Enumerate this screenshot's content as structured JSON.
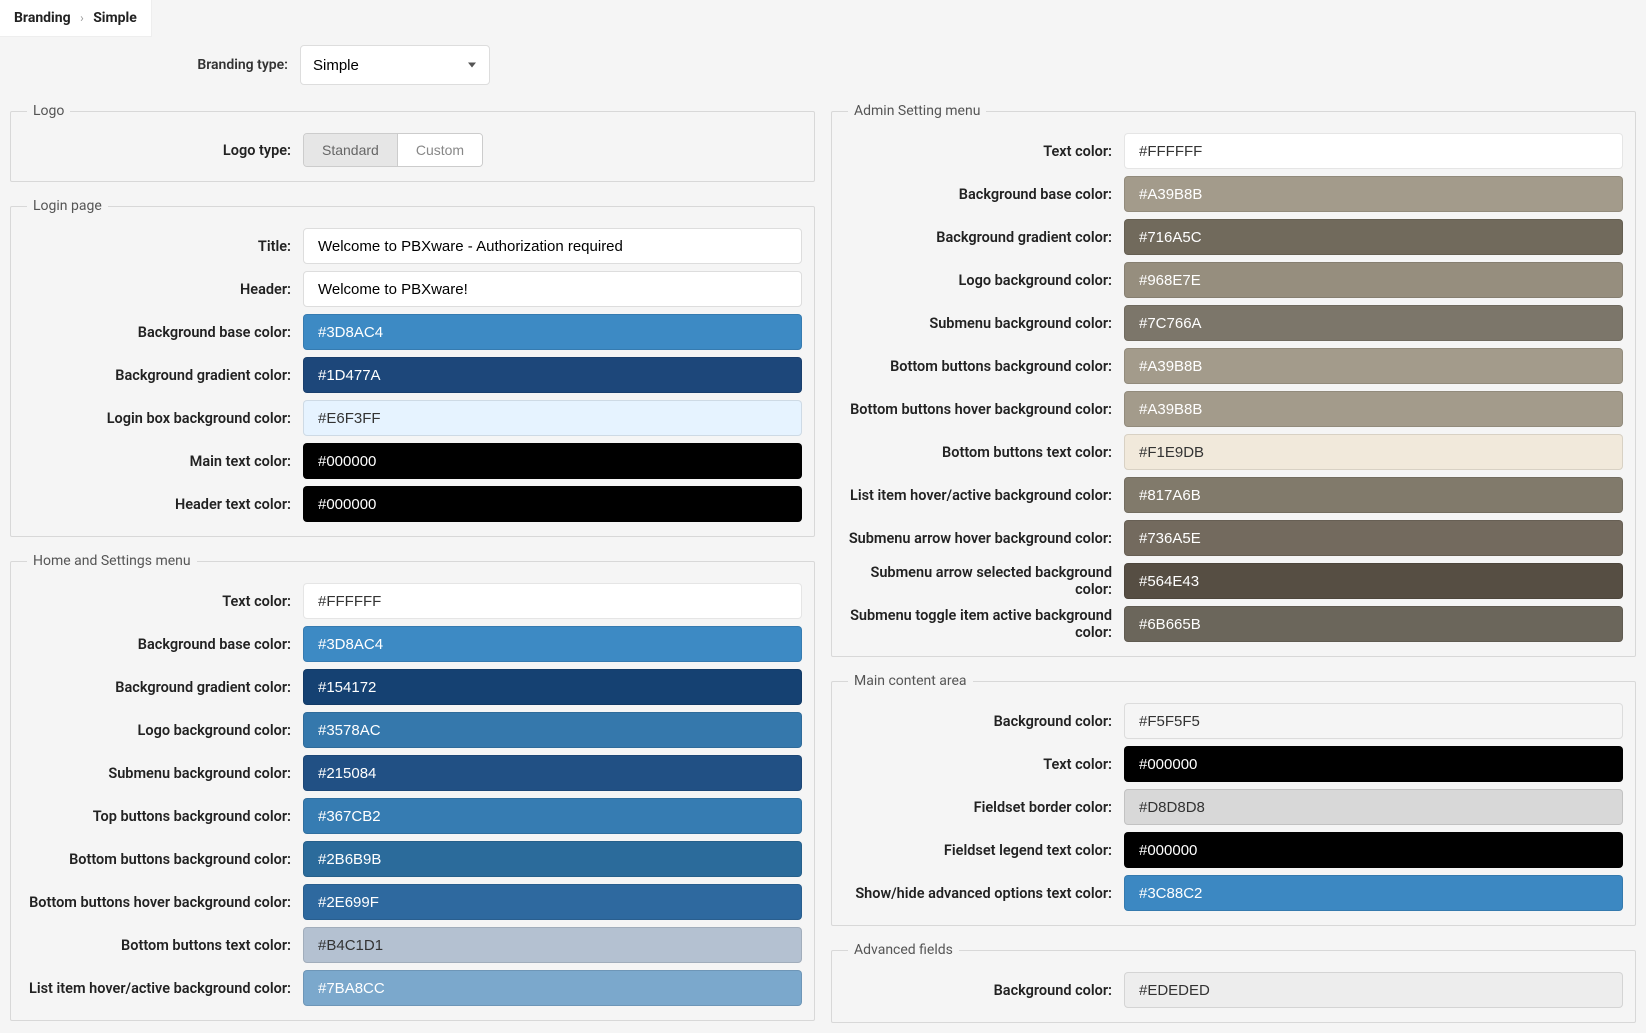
{
  "breadcrumb": {
    "root": "Branding",
    "current": "Simple"
  },
  "branding_type": {
    "label": "Branding type:",
    "value": "Simple"
  },
  "logo": {
    "legend": "Logo",
    "type_label": "Logo type:",
    "opt_standard": "Standard",
    "opt_custom": "Custom"
  },
  "login": {
    "legend": "Login page",
    "title_label": "Title:",
    "title_value": "Welcome to PBXware - Authorization required",
    "header_label": "Header:",
    "header_value": "Welcome to PBXware!",
    "bg_base_label": "Background base color:",
    "bg_base_value": "#3D8AC4",
    "bg_grad_label": "Background gradient color:",
    "bg_grad_value": "#1D477A",
    "box_bg_label": "Login box background color:",
    "box_bg_value": "#E6F3FF",
    "main_text_label": "Main text color:",
    "main_text_value": "#000000",
    "header_text_label": "Header text color:",
    "header_text_value": "#000000"
  },
  "home": {
    "legend": "Home and Settings menu",
    "text_color_label": "Text color:",
    "text_color_value": "#FFFFFF",
    "bg_base_label": "Background base color:",
    "bg_base_value": "#3D8AC4",
    "bg_grad_label": "Background gradient color:",
    "bg_grad_value": "#154172",
    "logo_bg_label": "Logo background color:",
    "logo_bg_value": "#3578AC",
    "submenu_bg_label": "Submenu background color:",
    "submenu_bg_value": "#215084",
    "top_btn_bg_label": "Top buttons background color:",
    "top_btn_bg_value": "#367CB2",
    "bot_btn_bg_label": "Bottom buttons background color:",
    "bot_btn_bg_value": "#2B6B9B",
    "bot_btn_hover_label": "Bottom buttons hover background color:",
    "bot_btn_hover_value": "#2E699F",
    "bot_btn_text_label": "Bottom buttons text color:",
    "bot_btn_text_value": "#B4C1D1",
    "list_hover_label": "List item hover/active background color:",
    "list_hover_value": "#7BA8CC"
  },
  "admin": {
    "legend": "Admin Setting menu",
    "text_color_label": "Text color:",
    "text_color_value": "#FFFFFF",
    "bg_base_label": "Background base color:",
    "bg_base_value": "#A39B8B",
    "bg_grad_label": "Background gradient color:",
    "bg_grad_value": "#716A5C",
    "logo_bg_label": "Logo background color:",
    "logo_bg_value": "#968E7E",
    "submenu_bg_label": "Submenu background color:",
    "submenu_bg_value": "#7C766A",
    "bot_btn_bg_label": "Bottom buttons background color:",
    "bot_btn_bg_value": "#A39B8B",
    "bot_btn_hover_label": "Bottom buttons hover background color:",
    "bot_btn_hover_value": "#A39B8B",
    "bot_btn_text_label": "Bottom buttons text color:",
    "bot_btn_text_value": "#F1E9DB",
    "list_hover_label": "List item hover/active background color:",
    "list_hover_value": "#817A6B",
    "arrow_hover_label": "Submenu arrow hover background color:",
    "arrow_hover_value": "#736A5E",
    "arrow_sel_label": "Submenu arrow selected background color:",
    "arrow_sel_value": "#564E43",
    "toggle_active_label": "Submenu toggle item active background color:",
    "toggle_active_value": "#6B665B"
  },
  "main_area": {
    "legend": "Main content area",
    "bg_label": "Background color:",
    "bg_value": "#F5F5F5",
    "text_label": "Text color:",
    "text_value": "#000000",
    "fieldset_border_label": "Fieldset border color:",
    "fieldset_border_value": "#D8D8D8",
    "fieldset_legend_label": "Fieldset legend text color:",
    "fieldset_legend_value": "#000000",
    "adv_opt_label": "Show/hide advanced options text color:",
    "adv_opt_value": "#3C88C2"
  },
  "advanced": {
    "legend": "Advanced fields",
    "bg_label": "Background color:",
    "bg_value": "#EDEDED"
  }
}
